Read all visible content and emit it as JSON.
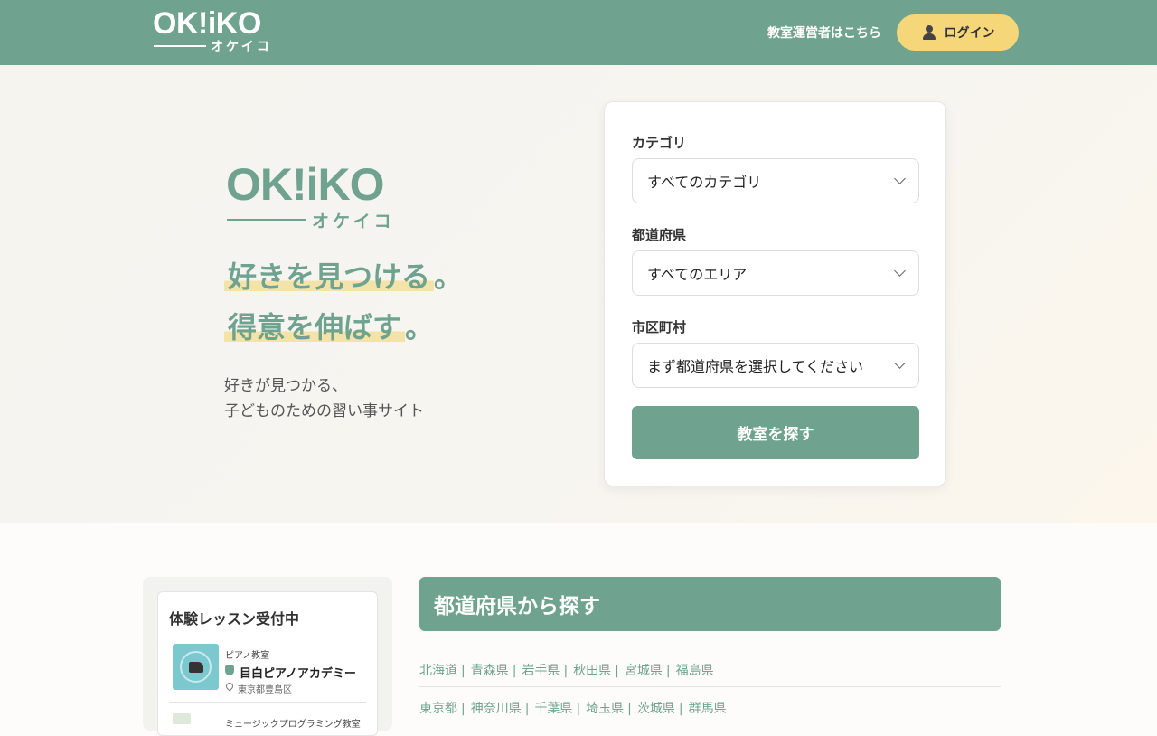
{
  "header": {
    "logo_main": "OK!iKO",
    "logo_sub": "オケイコ",
    "owner_link": "教室運営者はこちら",
    "login_label": "ログイン"
  },
  "hero": {
    "logo_main": "OK!iKO",
    "logo_sub": "オケイコ",
    "catch_line1": "好きを見つける",
    "catch_line1_end": "。",
    "catch_line2": "得意を伸ばす",
    "catch_line2_end": "。",
    "lead_line1": "好きが見つかる、",
    "lead_line2": "子どものための習い事サイト"
  },
  "search": {
    "category_label": "カテゴリ",
    "category_value": "すべてのカテゴリ",
    "prefecture_label": "都道府県",
    "prefecture_value": "すべてのエリア",
    "city_label": "市区町村",
    "city_value": "まず都道府県を選択してください",
    "submit_label": "教室を探す"
  },
  "sidebar": {
    "title": "体験レッスン受付中",
    "items": [
      {
        "category": "ピアノ教室",
        "name": "目白ピアノアカデミー",
        "location": "東京都豊島区"
      },
      {
        "category": "ミュージックプログラミング教室"
      }
    ]
  },
  "prefectures": {
    "heading": "都道府県から探す",
    "row1": [
      "北海道",
      "青森県",
      "岩手県",
      "秋田県",
      "宮城県",
      "福島県"
    ],
    "row2": [
      "東京都",
      "神奈川県",
      "千葉県",
      "埼玉県",
      "茨城県",
      "群馬県"
    ]
  },
  "colors": {
    "brand_green": "#6fa38f",
    "login_yellow": "#f5d77a",
    "highlight_yellow": "#f3e3a8"
  }
}
